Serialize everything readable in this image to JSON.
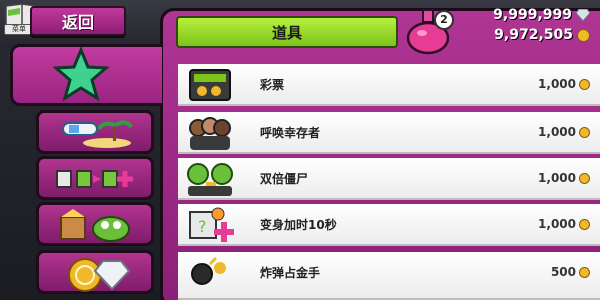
{
  "header": {
    "back_label": "返回",
    "menu_tag": "菜单",
    "section_title": "道具",
    "potion_count": "2",
    "diamonds": "9,999,999",
    "coins": "9,972,505"
  },
  "tabs": [
    {
      "name": "star-tab",
      "icon": "star-icon"
    },
    {
      "name": "powerup-tab",
      "icon": "scuba-island-icon"
    },
    {
      "name": "combo-tab",
      "icon": "bars-arrows-icon"
    },
    {
      "name": "zombie-tab",
      "icon": "zombie-fish-icon"
    },
    {
      "name": "coins-tab",
      "icon": "coin-diamond-icon"
    }
  ],
  "items": [
    {
      "name": "彩票",
      "price": "1,000",
      "icon": "lottery-ticket-icon"
    },
    {
      "name": "呼唤幸存者",
      "price": "1,000",
      "icon": "survivors-icon"
    },
    {
      "name": "双倍僵尸",
      "price": "1,000",
      "icon": "double-zombie-icon"
    },
    {
      "name": "变身加时10秒",
      "price": "1,000",
      "icon": "transform-time-icon"
    },
    {
      "name": "炸弹占金手",
      "price": "500",
      "icon": "bomb-icon"
    }
  ],
  "colors": {
    "panel": "#9b2883",
    "title_bar": "#8fd428",
    "row_bg": "#ffffff",
    "coin": "#f0b929",
    "diamond": "#c9d2da"
  }
}
